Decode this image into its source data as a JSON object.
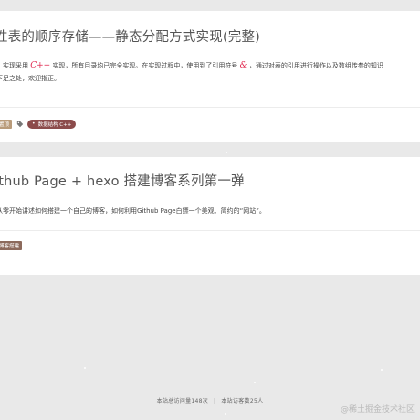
{
  "posts": [
    {
      "title": "性表的顺序存储——静态分配方式实现(完整)",
      "excerpt": {
        "line1_prefix": "，实现采用",
        "lang_mark": "C++",
        "line1_middle": "实现，所有目录均已完全实现。在实现过程中，使用到了引用符号",
        "ref_mark": "&",
        "line1_suffix": "，通过对表的引用进行操作以及数组传参的知识",
        "line2": "下足之处，欢迎指正。"
      },
      "category": "置顶",
      "tag": "数据结构 C++"
    },
    {
      "title": "ithub Page + hexo 搭建博客系列第一弹",
      "excerpt": {
        "line1": "从零开始讲述如何搭建一个自己的博客，如何利用Github Page白嫖一个美观、简约的“网站”。"
      },
      "category": "博客搭建"
    }
  ],
  "footer": {
    "views": "本站总访问量148次",
    "separator": "|",
    "visitors": "本站访客数25人"
  },
  "watermark": "@稀土掘金技术社区",
  "colors": {
    "background": "#e9e9e9",
    "card": "#ffffff",
    "category_badge": "#b99b7a",
    "tag_badge": "#8c4b4b",
    "math_accent": "#e0264d"
  }
}
